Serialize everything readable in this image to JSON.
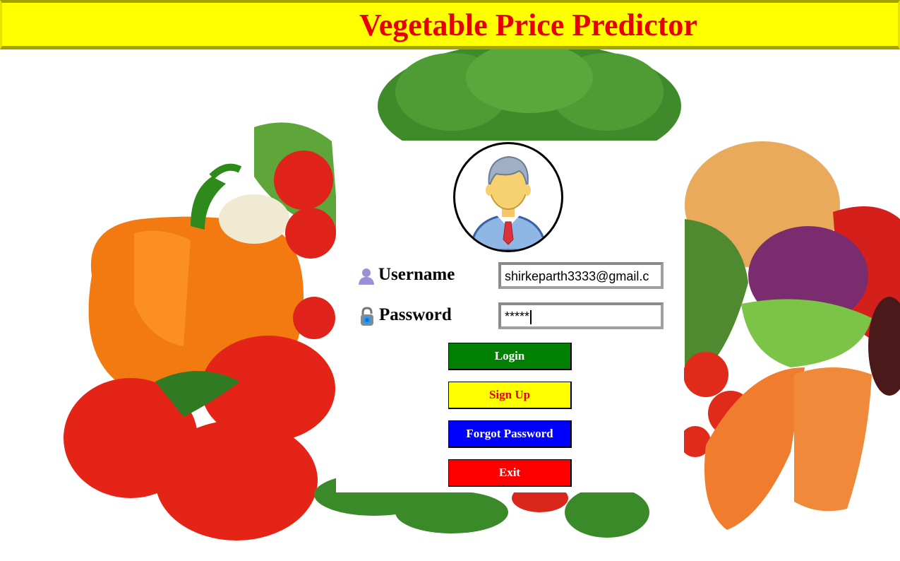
{
  "app": {
    "title": "Vegetable Price Predictor",
    "title_color": "#e60000",
    "title_bar_color": "#ffff00"
  },
  "login": {
    "username_label": "Username",
    "password_label": "Password",
    "username_value": "shirkeparth3333@gmail.c",
    "password_value": "*****",
    "icons": [
      "avatar-icon",
      "user-icon",
      "lock-icon"
    ]
  },
  "buttons": {
    "login": "Login",
    "signup": "Sign Up",
    "forgot": "Forgot Password",
    "exit": "Exit"
  },
  "colors": {
    "login_bg": "#008000",
    "signup_bg": "#ffff00",
    "forgot_bg": "#0000ff",
    "exit_bg": "#ff0000"
  }
}
